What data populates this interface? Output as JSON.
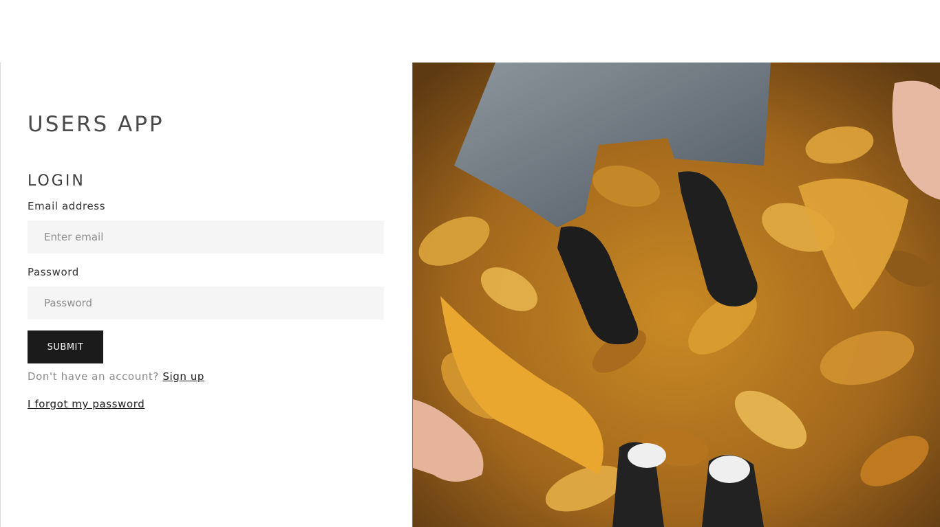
{
  "app": {
    "title": "USERS APP"
  },
  "login": {
    "heading": "LOGIN",
    "email": {
      "label": "Email address",
      "placeholder": "Enter email",
      "value": ""
    },
    "password": {
      "label": "Password",
      "placeholder": "Password",
      "value": ""
    },
    "submit_label": "SUBMIT",
    "signup_prompt": "Don't have an account?",
    "signup_link": "Sign up",
    "forgot_link": "I forgot my password"
  },
  "hero_image": {
    "subject": "autumn-leaves-sneakers-photo"
  },
  "colors": {
    "button_bg": "#1b1b1b",
    "input_bg": "#f5f5f6",
    "heading": "#4a4a4a",
    "muted_text": "#8a8a8a"
  }
}
